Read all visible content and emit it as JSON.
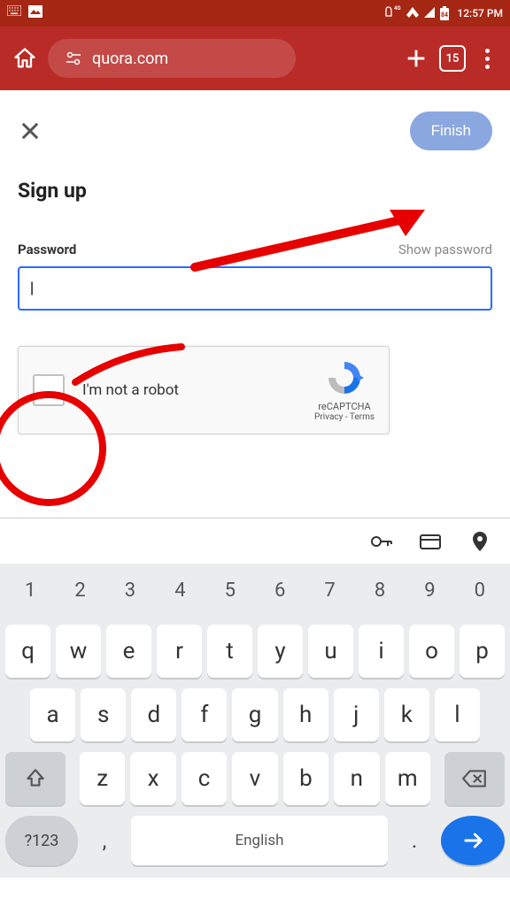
{
  "status": {
    "network": "4G",
    "battery": "84",
    "time": "12:57 PM"
  },
  "browser": {
    "url": "quora.com",
    "tab_count": "15"
  },
  "page": {
    "finish_label": "Finish",
    "title": "Sign up",
    "password_label": "Password",
    "show_password": "Show password",
    "recaptcha_label": "I'm not a robot",
    "recaptcha_name": "reCAPTCHA",
    "recaptcha_privacy": "Privacy",
    "recaptcha_terms": "Terms"
  },
  "keyboard": {
    "numbers": [
      "1",
      "2",
      "3",
      "4",
      "5",
      "6",
      "7",
      "8",
      "9",
      "0"
    ],
    "row1": [
      "q",
      "w",
      "e",
      "r",
      "t",
      "y",
      "u",
      "i",
      "o",
      "p"
    ],
    "row2": [
      "a",
      "s",
      "d",
      "f",
      "g",
      "h",
      "j",
      "k",
      "l"
    ],
    "row3": [
      "z",
      "x",
      "c",
      "v",
      "b",
      "n",
      "m"
    ],
    "sym": "?123",
    "space": "English",
    "comma": ",",
    "dot": "."
  }
}
